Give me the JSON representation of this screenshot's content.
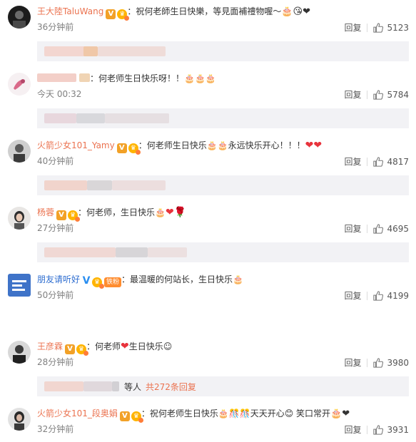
{
  "comments": [
    {
      "username": "王大陸TaluWang",
      "text": "：祝何老師生日快樂，等見面補禮物喔～",
      "trailing_emoji": "🎂😘❤",
      "time": "36分钟前",
      "reply_label": "回复",
      "likes": "5123"
    },
    {
      "username": "",
      "text": "：何老师生日快乐呀！！🎂🎂🎂",
      "time": "今天 00:32",
      "reply_label": "回复",
      "likes": "5784"
    },
    {
      "username": "火箭少女101_Yamy",
      "text": "：何老师生日快乐🎂🎂永远快乐开心！！！",
      "trailing_emoji": "❤❤",
      "time": "40分钟前",
      "reply_label": "回复",
      "likes": "4817"
    },
    {
      "username": "杨蓉",
      "text": "：何老师，生日快乐🎂",
      "trailing_emoji": "❤🌹",
      "time": "27分钟前",
      "reply_label": "回复",
      "likes": "4695"
    },
    {
      "username": "朋友请听好",
      "badge_fan": "铁粉",
      "text": "：最温暖的何站长，生日快乐🎂",
      "time": "50分钟前",
      "reply_label": "回复",
      "likes": "4199"
    },
    {
      "username": "王彦霖",
      "text": "：何老师",
      "text_after_heart": "生日快乐☺",
      "time": "28分钟前",
      "reply_label": "回复",
      "likes": "3980",
      "sub_more": {
        "prefix": "等人",
        "link": "共272条回复"
      }
    },
    {
      "username": "火箭少女101_段奥娟",
      "text": "：祝何老师生日快乐🎂🎊🎊天天开心😊 笑口常开",
      "trailing_emoji": "🎂❤",
      "time": "32分钟前",
      "reply_label": "回复",
      "likes": "3931"
    }
  ],
  "icons": {
    "like": "thumbs-up-icon",
    "verified": "verified-v-icon",
    "crown": "crown-badge-icon"
  },
  "colors": {
    "username": "#eb7350",
    "meta": "#808080",
    "subbox": "#f2f2f5",
    "heart": "#e8333c",
    "verified_orange": "#f2a127",
    "verified_blue": "#2a8ef0"
  }
}
